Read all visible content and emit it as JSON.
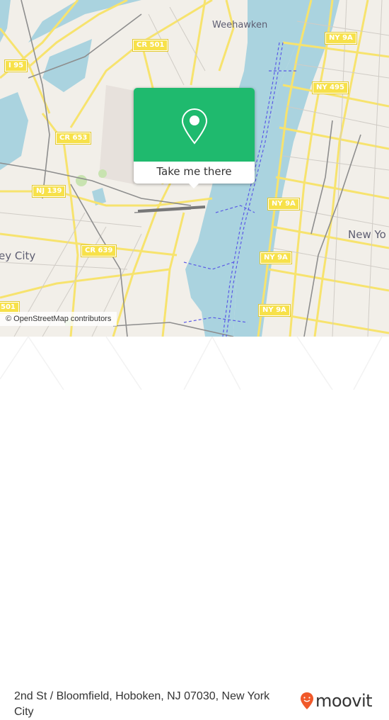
{
  "map": {
    "place_labels": [
      {
        "id": "weehawken",
        "text": "Weehawken"
      },
      {
        "id": "new-york",
        "text": "New Yo"
      },
      {
        "id": "jersey-city",
        "text": "ey City"
      }
    ],
    "road_shields": [
      {
        "id": "i95",
        "text": "I 95"
      },
      {
        "id": "cr501-top",
        "text": "CR 501"
      },
      {
        "id": "ny9a-top",
        "text": "NY 9A"
      },
      {
        "id": "ny495",
        "text": "NY 495"
      },
      {
        "id": "cr653",
        "text": "CR 653"
      },
      {
        "id": "nj139",
        "text": "NJ 139"
      },
      {
        "id": "ny9a-mid",
        "text": "NY 9A"
      },
      {
        "id": "cr639",
        "text": "CR 639"
      },
      {
        "id": "ny9a-low",
        "text": "NY 9A"
      },
      {
        "id": "ny9a-bottom",
        "text": "NY 9A"
      },
      {
        "id": "cr501-left",
        "text": "501"
      }
    ],
    "attribution": "© OpenStreetMap contributors"
  },
  "popup": {
    "icon": "location-pin-icon",
    "button_label": "Take me there",
    "accent_color": "#1fba6e"
  },
  "footer": {
    "address": "2nd St / Bloomfield, Hoboken, NJ 07030, New York City",
    "brand": "moovit",
    "brand_color": "#f0592a"
  }
}
